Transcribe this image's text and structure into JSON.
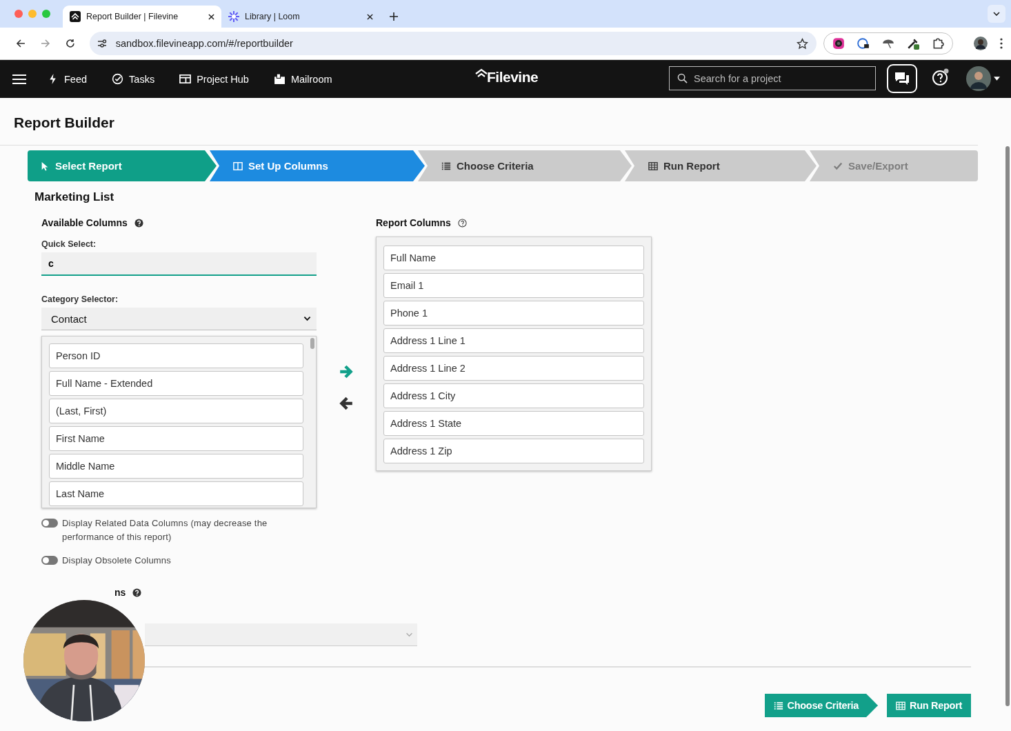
{
  "browser": {
    "tabs": [
      {
        "title": "Report Builder | Filevine",
        "selected": true
      },
      {
        "title": "Library | Loom",
        "selected": false
      }
    ],
    "url": "sandbox.filevineapp.com/#/reportbuilder"
  },
  "navbar": {
    "items": [
      {
        "label": "Feed"
      },
      {
        "label": "Tasks"
      },
      {
        "label": "Project Hub"
      },
      {
        "label": "Mailroom"
      }
    ],
    "logo": "Filevine",
    "search": {
      "placeholder": "Search for a project"
    }
  },
  "page_title": "Report Builder",
  "steps": [
    {
      "label": "Select Report",
      "completed": true,
      "selected": false,
      "disabled": false
    },
    {
      "label": "Set Up Columns",
      "completed": false,
      "selected": true,
      "disabled": false
    },
    {
      "label": "Choose Criteria",
      "completed": false,
      "selected": false,
      "disabled": false
    },
    {
      "label": "Run Report",
      "completed": false,
      "selected": false,
      "disabled": false
    },
    {
      "label": "Save/Export",
      "completed": false,
      "selected": false,
      "disabled": true
    }
  ],
  "report_name": "Marketing List",
  "available": {
    "heading": "Available Columns",
    "quick_select": {
      "label": "Quick Select:",
      "value": "c"
    },
    "category": {
      "label": "Category Selector:",
      "value": "Contact"
    },
    "items": [
      "Person ID",
      "Full Name - Extended",
      "(Last, First)",
      "First Name",
      "Middle Name",
      "Last Name"
    ]
  },
  "report_columns": {
    "heading": "Report Columns",
    "items": [
      "Full Name",
      "Email 1",
      "Phone 1",
      "Address 1 Line 1",
      "Address 1 Line 2",
      "Address 1 City",
      "Address 1 State",
      "Address 1 Zip"
    ]
  },
  "toggles": [
    {
      "label": "Display Related Data Columns (may decrease the performance of this report)",
      "on": false
    },
    {
      "label": "Display Obsolete Columns",
      "on": false
    }
  ],
  "section_heading_visible": "ns",
  "footer_buttons": [
    "Choose Criteria",
    "Run Report"
  ]
}
